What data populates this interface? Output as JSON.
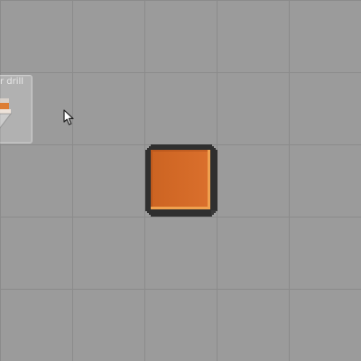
{
  "scene": {
    "background": "#9b9b9b",
    "grid_line_color": "#8b8b8b"
  },
  "build_preview": {
    "label": "r drill",
    "icon": "drill-icon"
  },
  "selected_block": {
    "name": "drill",
    "color": "#d96a24"
  },
  "cursor": {
    "icon": "arrow-cursor-icon"
  }
}
